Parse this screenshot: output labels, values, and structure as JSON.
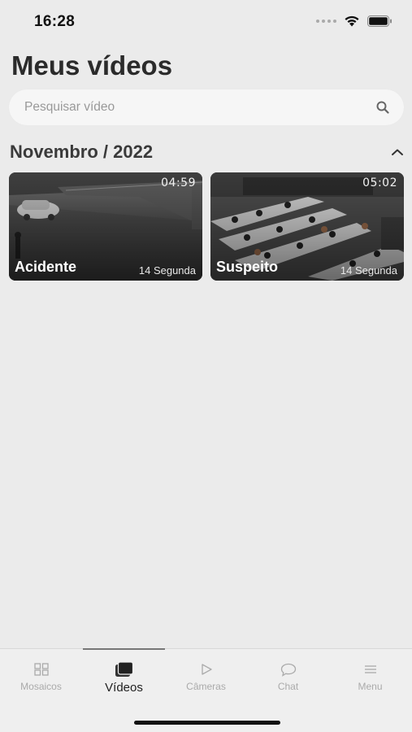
{
  "status_bar": {
    "time": "16:28"
  },
  "page": {
    "title": "Meus vídeos"
  },
  "search": {
    "placeholder": "Pesquisar vídeo",
    "value": ""
  },
  "section": {
    "title": "Novembro / 2022"
  },
  "videos": [
    {
      "title": "Acidente",
      "duration": "04:59",
      "date": "14 Segunda"
    },
    {
      "title": "Suspeito",
      "duration": "05:02",
      "date": "14 Segunda"
    }
  ],
  "tab_bar": {
    "active": "Vídeos",
    "tabs": [
      {
        "label": "Mosaicos",
        "icon": "grid-icon"
      },
      {
        "label": "Vídeos",
        "icon": "videos-icon"
      },
      {
        "label": "Câmeras",
        "icon": "play-icon"
      },
      {
        "label": "Chat",
        "icon": "chat-bubble-icon"
      },
      {
        "label": "Menu",
        "icon": "menu-icon"
      }
    ]
  },
  "colors": {
    "background": "#ebebeb",
    "tab_inactive": "#aaaaaa",
    "tab_active": "#222222"
  }
}
